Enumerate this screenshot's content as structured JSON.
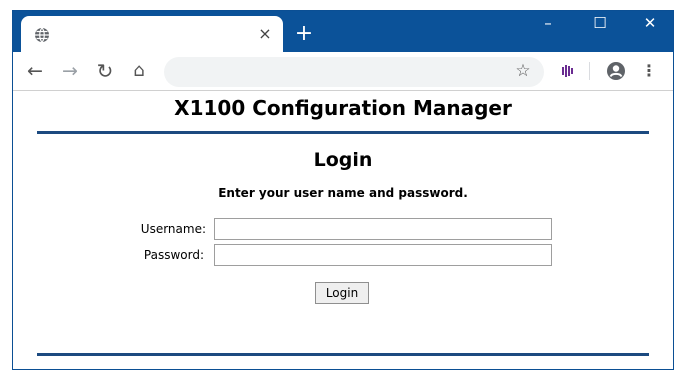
{
  "browser": {
    "tab_close_glyph": "×",
    "new_tab_glyph": "+",
    "window_controls": {
      "minimize": "–",
      "maximize": "☐",
      "close": "✕"
    },
    "nav": {
      "back": "←",
      "forward": "→",
      "reload": "↻",
      "home": "⌂"
    },
    "address_value": "",
    "star_glyph": "☆",
    "menu_glyph": "⋮",
    "icons": [
      "globe-icon",
      "bookmark-star-icon",
      "extension-icon",
      "profile-icon",
      "menu-icon"
    ],
    "accent_color": "#0b5299"
  },
  "page": {
    "app_title": "X1100 Configuration Manager",
    "login_heading": "Login",
    "instructions": "Enter your user name and password.",
    "username_label": "Username:",
    "password_label": "Password:",
    "username_value": "",
    "password_value": "",
    "login_button": "Login",
    "rule_color": "#1c4a80"
  }
}
